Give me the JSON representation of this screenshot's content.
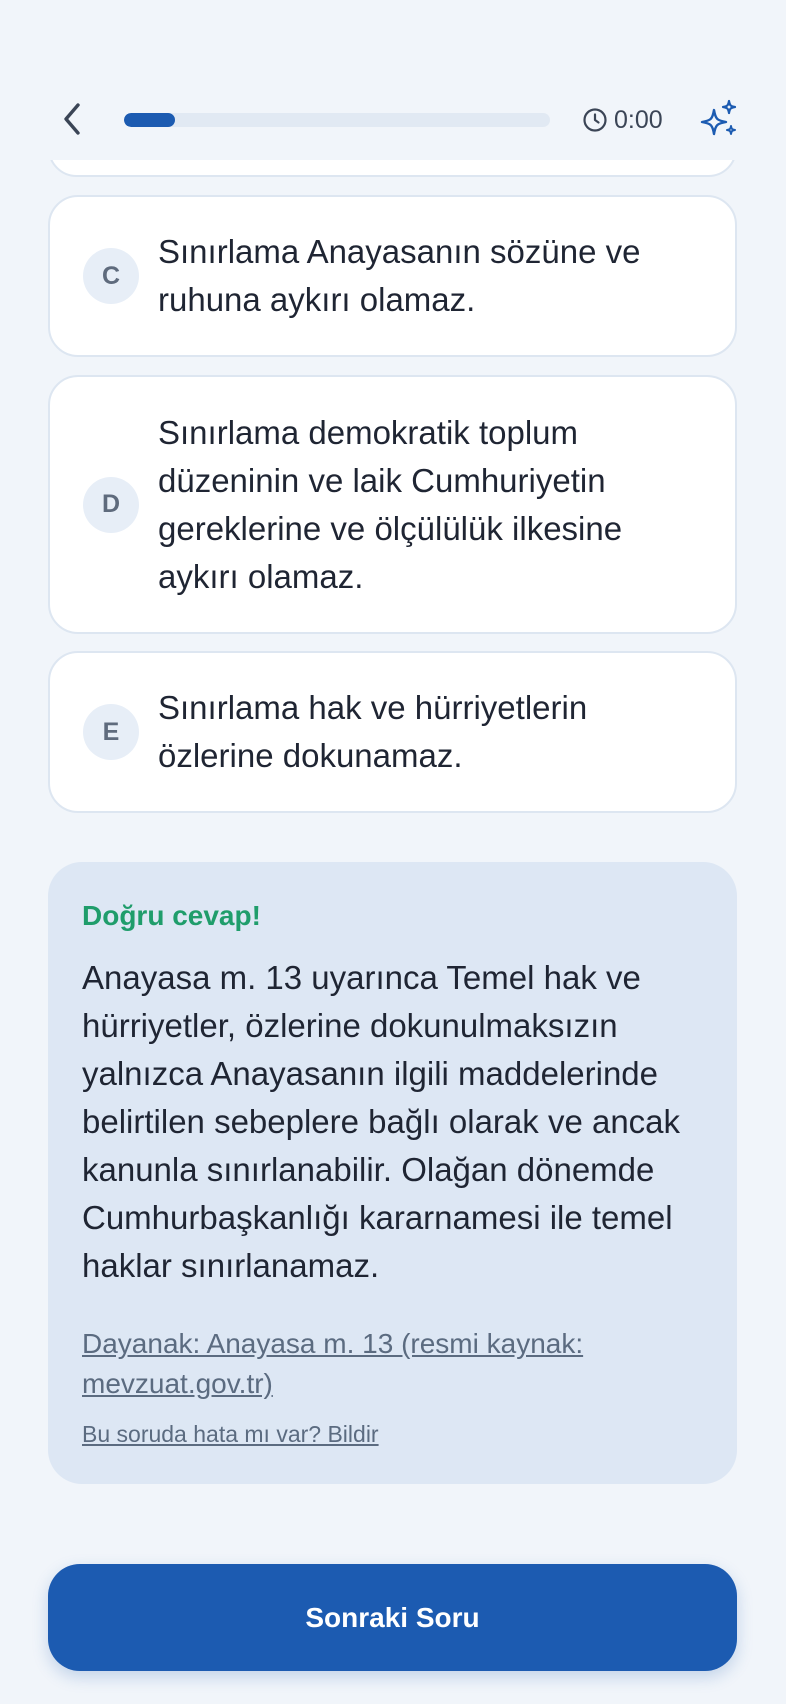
{
  "header": {
    "progress_fraction": 0.12,
    "timer": "0:00",
    "icons": {
      "back": "chevron-left-icon",
      "timer": "clock-icon",
      "ai": "sparkles-icon"
    }
  },
  "options": [
    {
      "letter": "C",
      "text": "Sınırlama Anayasanın sözüne ve ruhuna aykırı olamaz."
    },
    {
      "letter": "D",
      "text": "Sınırlama demokratik toplum düzeninin ve laik Cumhuriyetin gereklerine ve ölçülülük ilkesine aykırı olamaz."
    },
    {
      "letter": "E",
      "text": "Sınırlama hak ve hürriyetlerin özlerine dokunamaz."
    }
  ],
  "feedback": {
    "title": "Doğru cevap!",
    "explanation": "Anayasa m. 13 uyarınca Temel hak ve hürriyetler, özlerine dokunulmaksızın yalnızca Anayasanın ilgili maddelerinde belirtilen sebeplere bağlı olarak ve ancak kanunla sınırlanabilir. Olağan dönemde Cumhurbaşkanlığı kararnamesi ile temel haklar sınırlanamaz.",
    "source": "Dayanak: Anayasa m. 13 (resmi kaynak: mevzuat.gov.tr)",
    "report": "Bu soruda hata mı var? Bildir"
  },
  "next_button": "Sonraki Soru",
  "colors": {
    "accent": "#1c5bb1",
    "success": "#1f9d6b",
    "background": "#f1f5fa",
    "panel": "#dde7f4"
  }
}
